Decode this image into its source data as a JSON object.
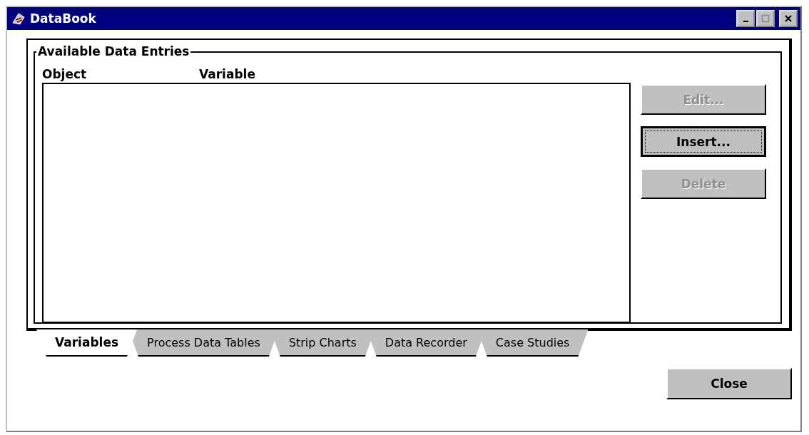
{
  "window": {
    "title": "DataBook"
  },
  "group": {
    "label": "Available Data Entries"
  },
  "list": {
    "columns": [
      "Object",
      "Variable"
    ]
  },
  "buttons": [
    {
      "label": "Edit...",
      "disabled": true,
      "focused": false
    },
    {
      "label": "Insert...",
      "disabled": false,
      "focused": true
    },
    {
      "label": "Delete",
      "disabled": true,
      "focused": false
    }
  ],
  "tabs": [
    {
      "label": "Variables",
      "selected": true
    },
    {
      "label": "Process Data Tables",
      "selected": false
    },
    {
      "label": "Strip Charts",
      "selected": false
    },
    {
      "label": "Data Recorder",
      "selected": false
    },
    {
      "label": "Case Studies",
      "selected": false
    }
  ],
  "close_button": {
    "label": "Close"
  }
}
